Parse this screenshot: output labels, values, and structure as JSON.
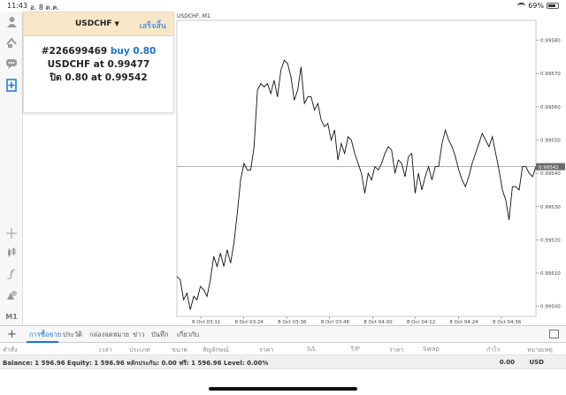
{
  "status": {
    "time": "11:43",
    "date": "อ. 8 ต.ค.",
    "battery": "69%"
  },
  "sidebar": {
    "icons": [
      "user-icon",
      "transfer-icon",
      "chat-icon",
      "add-order-icon",
      "crosshair-icon",
      "candles-icon",
      "function-icon",
      "objects-icon"
    ],
    "timeframe": "M1"
  },
  "order_panel": {
    "symbol": "USDCHF",
    "done_label": "เสร็จสิ้น",
    "ticket": "#226699469",
    "action": "buy 0.80",
    "open_line": "USDCHF at 0.99477",
    "close_line": "ปิด 0.80 at 0.99542"
  },
  "chart_data": {
    "type": "line",
    "title": "USDCHF, M1",
    "x_labels": [
      "8 Oct 03:11",
      "8 Oct 03:24",
      "8 Oct 03:36",
      "8 Oct 03:48",
      "8 Oct 04:00",
      "8 Oct 04:12",
      "8 Oct 04:24",
      "8 Oct 04:36"
    ],
    "y_ticks": [
      "0.99580",
      "0.99570",
      "0.99560",
      "0.99550",
      "0.99540",
      "0.99530",
      "0.99520",
      "0.99510",
      "0.99500"
    ],
    "ylim": [
      0.99497,
      0.99586
    ],
    "current_price": "0.99542",
    "current_value": 0.99542,
    "series": [
      {
        "values": [
          0.99509,
          0.99508,
          0.99502,
          0.99504,
          0.99499,
          0.99503,
          0.99502,
          0.99506,
          0.99505,
          0.99503,
          0.99508,
          0.99515,
          0.99512,
          0.99516,
          0.99512,
          0.99517,
          0.99513,
          0.99519,
          0.99528,
          0.99538,
          0.99543,
          0.99541,
          0.99541,
          0.99548,
          0.99565,
          0.99567,
          0.99566,
          0.99567,
          0.99564,
          0.99568,
          0.99563,
          0.99571,
          0.99574,
          0.99573,
          0.99569,
          0.99562,
          0.99565,
          0.99572,
          0.99561,
          0.99563,
          0.99563,
          0.99559,
          0.99561,
          0.99556,
          0.99554,
          0.99555,
          0.9955,
          0.99553,
          0.99544,
          0.99549,
          0.99546,
          0.99551,
          0.9955,
          0.99546,
          0.99543,
          0.9954,
          0.99534,
          0.9954,
          0.99538,
          0.99542,
          0.99541,
          0.99543,
          0.99546,
          0.99548,
          0.99547,
          0.9954,
          0.99544,
          0.99543,
          0.99539,
          0.99545,
          0.99546,
          0.99534,
          0.9954,
          0.99535,
          0.99539,
          0.99542,
          0.99538,
          0.99542,
          0.99542,
          0.99549,
          0.99553,
          0.9955,
          0.99548,
          0.99545,
          0.99541,
          0.99538,
          0.99536,
          0.99539,
          0.99543,
          0.99546,
          0.99549,
          0.99552,
          0.9955,
          0.99548,
          0.99551,
          0.99546,
          0.99541,
          0.99535,
          0.99532,
          0.99526,
          0.99536,
          0.99536,
          0.99535,
          0.99542,
          0.99542,
          0.9954,
          0.99539,
          0.99542
        ]
      }
    ]
  },
  "tabs": [
    {
      "label": "การซื้อขาย",
      "active": true
    },
    {
      "label": "ประวัติ",
      "active": false
    },
    {
      "label": "กล่องจดหมาย",
      "active": false
    },
    {
      "label": "ข่าว",
      "active": false
    },
    {
      "label": "บันทึก",
      "active": false
    },
    {
      "label": "เกี่ยวกับ",
      "active": false
    }
  ],
  "table_headers": [
    "คำสั่ง",
    "เวลา",
    "ประเภท",
    "ขนาด",
    "สัญลักษณ์",
    "ราคา",
    "S/L",
    "T/P",
    "ราคา",
    "Swap",
    "กำไร",
    "หมายเหตุ"
  ],
  "balance": {
    "text": "Balance: 1 596.96 Equity: 1 596.96 หลักประกัน: 0.00 ฟรี: 1 596.96 Level: 0.00%",
    "value": "0.00",
    "currency": "USD"
  }
}
